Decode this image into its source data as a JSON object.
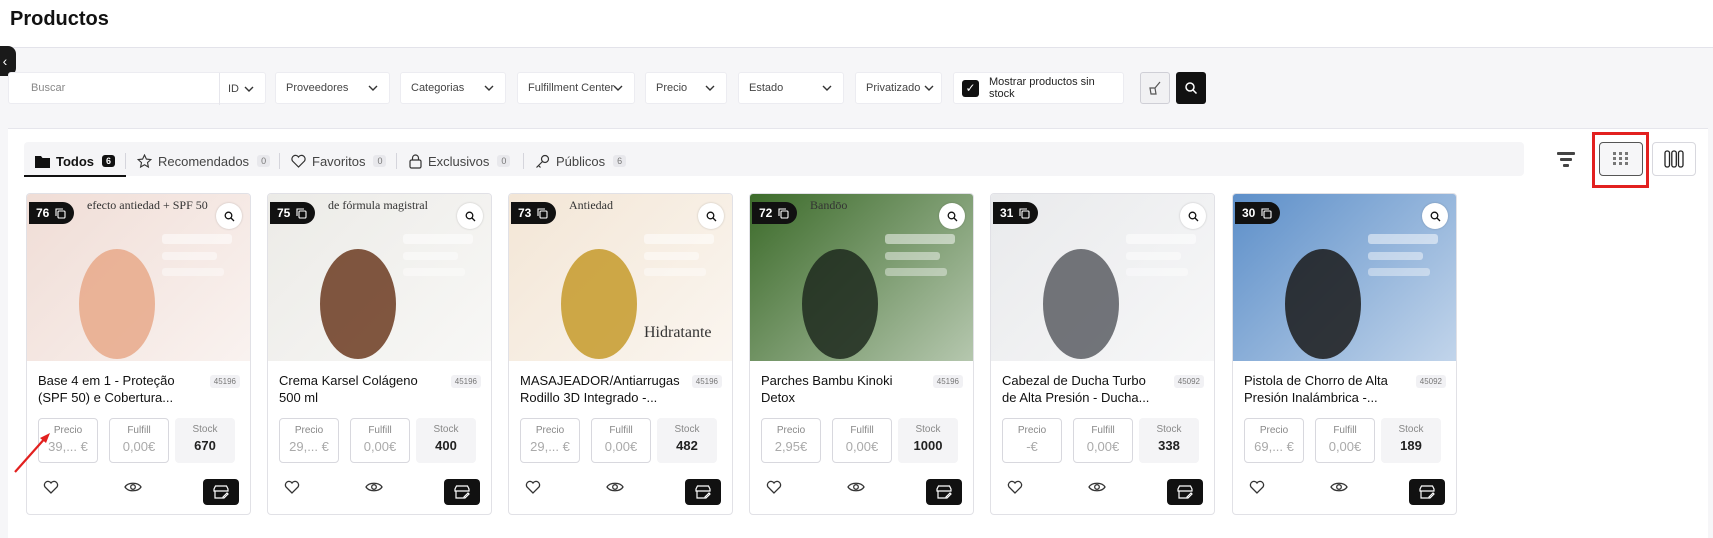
{
  "page": {
    "title": "Productos"
  },
  "filters": {
    "search_placeholder": "Buscar",
    "id_label": "ID",
    "proveedores": "Proveedores",
    "categorias": "Categorias",
    "fulfillment": "Fulfillment Center",
    "precio": "Precio",
    "estado": "Estado",
    "privatizado": "Privatizado",
    "mostrar_sin_stock": "Mostrar productos sin stock"
  },
  "tabs": [
    {
      "label": "Todos",
      "count": "6",
      "icon": "folder-icon"
    },
    {
      "label": "Recomendados",
      "count": "0",
      "icon": "star-icon"
    },
    {
      "label": "Favoritos",
      "count": "0",
      "icon": "heart-icon"
    },
    {
      "label": "Exclusivos",
      "count": "0",
      "icon": "lock-icon"
    },
    {
      "label": "Públicos",
      "count": "6",
      "icon": "key-icon"
    }
  ],
  "products": [
    {
      "num": "76",
      "name": "Base 4 em 1 - Proteção (SPF 50) e Cobertura...",
      "code": "45196",
      "precio": "39,... €",
      "fulfill": "0,00€",
      "stock": "670",
      "img_bg": "#f0ddd6",
      "img_fg": "#e8a98a",
      "img_text": "efecto antiedad + SPF 50"
    },
    {
      "num": "75",
      "name": "Crema Karsel Colágeno 500 ml",
      "code": "45196",
      "precio": "29,... €",
      "fulfill": "0,00€",
      "stock": "400",
      "img_bg": "#ecebe7",
      "img_fg": "#6b3a20",
      "img_text": "de fórmula magistral"
    },
    {
      "num": "73",
      "name": "MASAJEADOR/Antiarrugas Rodillo 3D Integrado -...",
      "code": "45196",
      "precio": "29,... €",
      "fulfill": "0,00€",
      "stock": "482",
      "img_bg": "#f3e6d6",
      "img_fg": "#c59a2a",
      "img_text": "Antiedad",
      "img_text2": "Hidratante"
    },
    {
      "num": "72",
      "name": "Parches Bambu Kinoki Detox",
      "code": "45196",
      "precio": "2,95€",
      "fulfill": "0,00€",
      "stock": "1000",
      "img_bg": "#3c6b2a",
      "img_fg": "#1f2a1f",
      "img_text": "Bandōo"
    },
    {
      "num": "31",
      "name": "Cabezal de Ducha Turbo de Alta Presión - Ducha...",
      "code": "45092",
      "precio": "-€",
      "fulfill": "0,00€",
      "stock": "338",
      "img_bg": "#e9eaec",
      "img_fg": "#5a5d63",
      "img_text": ""
    },
    {
      "num": "30",
      "name": "Pistola de Chorro de Alta Presión Inalámbrica -...",
      "code": "45092",
      "precio": "69,... €",
      "fulfill": "0,00€",
      "stock": "189",
      "img_bg": "#5d8fc9",
      "img_fg": "#1b1b1b",
      "img_text": ""
    }
  ],
  "labels": {
    "precio": "Precio",
    "fulfill": "Fulfill",
    "stock": "Stock"
  }
}
